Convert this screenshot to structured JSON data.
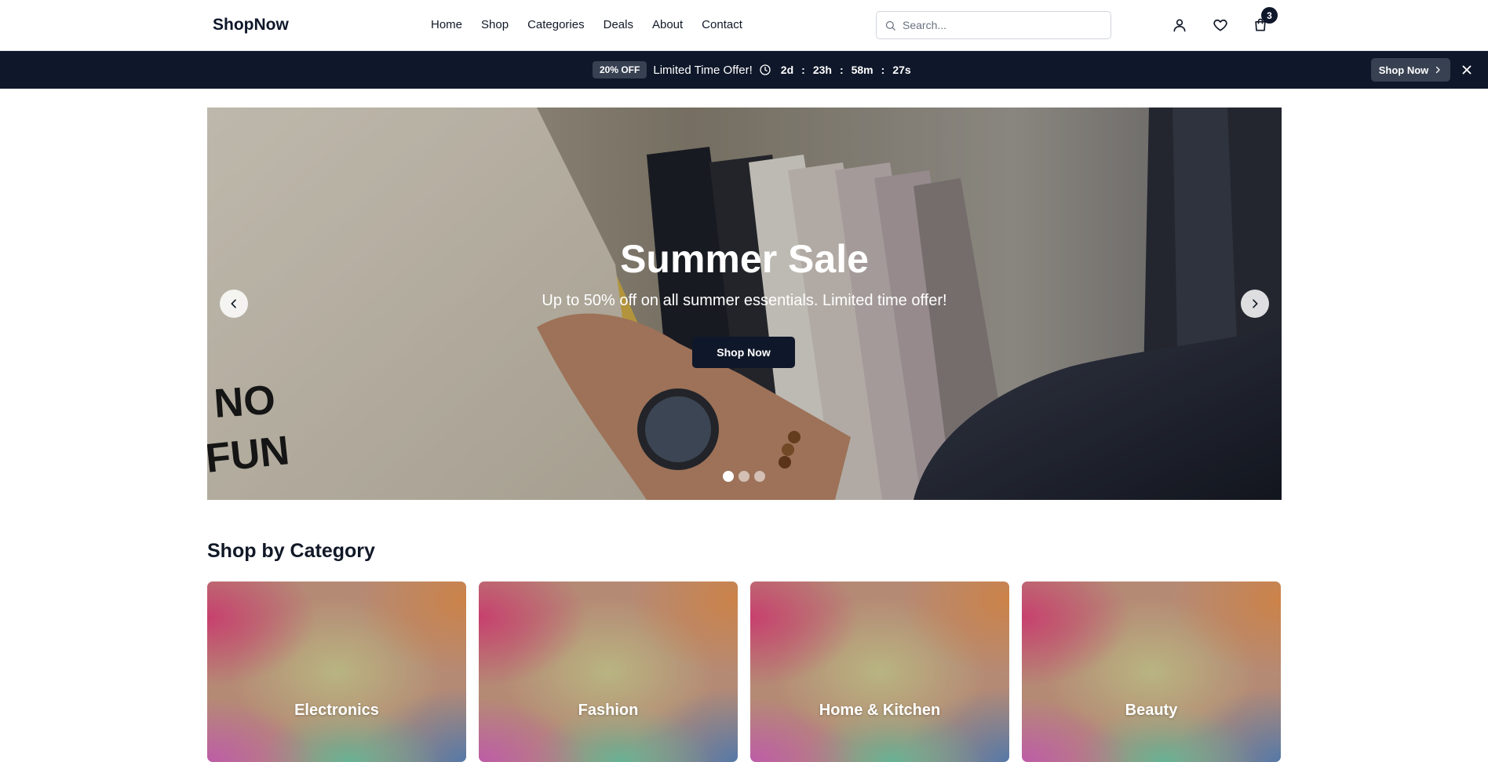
{
  "header": {
    "logo": "ShopNow",
    "nav": [
      "Home",
      "Shop",
      "Categories",
      "Deals",
      "About",
      "Contact"
    ],
    "search": {
      "placeholder": "Search...",
      "value": ""
    },
    "icons": [
      "user-icon",
      "heart-icon",
      "shopping-bag-icon"
    ],
    "cart_count": "3"
  },
  "promo": {
    "badge": "20% OFF",
    "text": "Limited Time Offer!",
    "countdown": {
      "days": "2d",
      "hours": "23h",
      "minutes": "58m",
      "seconds": "27s",
      "separator": ":"
    },
    "button_label": "Shop Now"
  },
  "hero": {
    "title": "Summer Sale",
    "subtitle": "Up to 50% off on all summer essentials. Limited time offer!",
    "button_label": "Shop Now",
    "slide_count": 3,
    "active_slide": 1,
    "shirt_print": "NO FUN"
  },
  "categories": {
    "title": "Shop by Category",
    "items": [
      "Electronics",
      "Fashion",
      "Home & Kitchen",
      "Beauty"
    ]
  },
  "colors": {
    "primary": "#0f172a",
    "promo_badge": "#374151",
    "text": "#111827",
    "border": "#e5e7eb"
  }
}
